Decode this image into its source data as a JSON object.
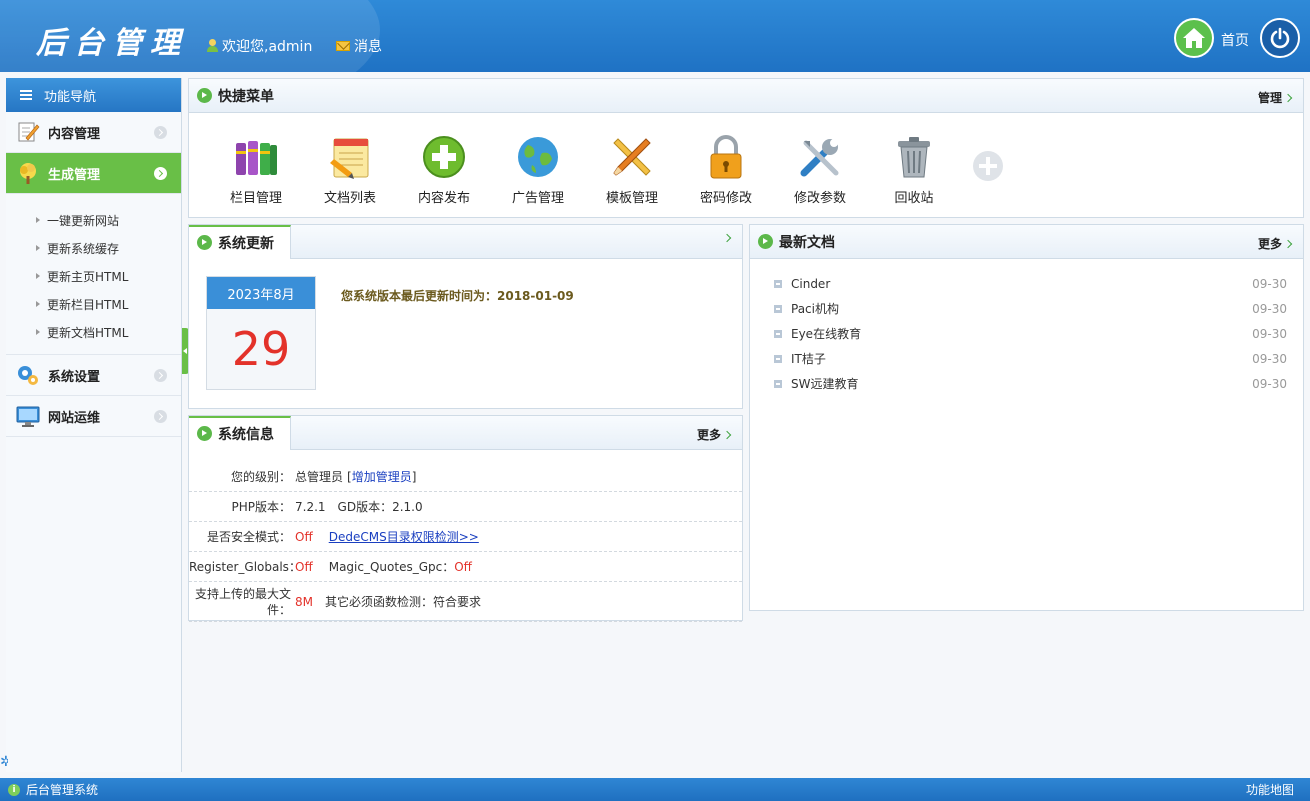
{
  "header": {
    "logo": "后台管理",
    "welcome": "欢迎您,admin",
    "message": "消息",
    "home_label": "首页"
  },
  "sidebar": {
    "title": "功能导航",
    "menus": [
      {
        "label": "内容管理"
      },
      {
        "label": "生成管理",
        "submenu": [
          "一键更新网站",
          "更新系统缓存",
          "更新主页HTML",
          "更新栏目HTML",
          "更新文档HTML"
        ]
      },
      {
        "label": "系统设置"
      },
      {
        "label": "网站运维"
      }
    ]
  },
  "quick_menu": {
    "title": "快捷菜单",
    "more": "管理",
    "items": [
      {
        "label": "栏目管理",
        "icon": "books-icon"
      },
      {
        "label": "文档列表",
        "icon": "notepad-icon"
      },
      {
        "label": "内容发布",
        "icon": "plus-circle-icon"
      },
      {
        "label": "广告管理",
        "icon": "globe-icon"
      },
      {
        "label": "模板管理",
        "icon": "pencil-ruler-icon"
      },
      {
        "label": "密码修改",
        "icon": "lock-icon"
      },
      {
        "label": "修改参数",
        "icon": "tools-icon"
      },
      {
        "label": "回收站",
        "icon": "trash-icon"
      }
    ]
  },
  "system_update": {
    "title": "系统更新",
    "calendar_month": "2023年8月",
    "calendar_day": "29",
    "text": "您系统版本最后更新时间为：2018-01-09"
  },
  "system_info": {
    "title": "系统信息",
    "more": "更多",
    "rows": [
      {
        "label": "您的级别：",
        "value": "总管理员",
        "link_open": "[",
        "link": "增加管理员",
        "link_close": "]"
      },
      {
        "label": "PHP版本：",
        "value": "7.2.1",
        "label2": "GD版本：",
        "value2": "2.1.0"
      },
      {
        "label": "是否安全模式：",
        "value": "Off",
        "link": "DedeCMS目录权限检测>>"
      },
      {
        "label": "Register_Globals：",
        "value": "Off",
        "label2": "Magic_Quotes_Gpc：",
        "value2": "Off"
      },
      {
        "label": "支持上传的最大文件：",
        "value": "8M",
        "label2": "其它必须函数检测：",
        "value2": "符合要求"
      }
    ]
  },
  "latest_docs": {
    "title": "最新文档",
    "more": "更多",
    "items": [
      {
        "title": "Cinder",
        "date": "09-30"
      },
      {
        "title": "Paci机构",
        "date": "09-30"
      },
      {
        "title": "Eye在线教育",
        "date": "09-30"
      },
      {
        "title": "IT桔子",
        "date": "09-30"
      },
      {
        "title": "SW远建教育",
        "date": "09-30"
      }
    ]
  },
  "footer": {
    "left": "后台管理系统",
    "right": "功能地图"
  },
  "colors": {
    "header_blue": "#2f8ad8",
    "accent_green": "#69bf47",
    "red": "#e3322a"
  }
}
